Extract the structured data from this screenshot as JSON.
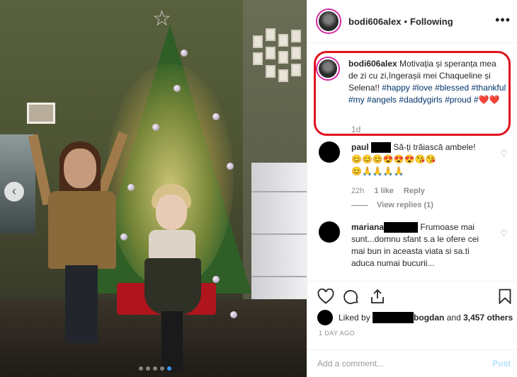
{
  "post": {
    "username": "bodi606alex",
    "separator": "•",
    "follow_status": "Following",
    "more_label": "•••",
    "caption_user": "bodi606alex",
    "caption_text": "Motivația și speranța mea de zi cu zi,îngerașii mei Chaqueline și Selena!!",
    "hashtags": [
      "#happy",
      "#love",
      "#blessed",
      "#thankful",
      "#my",
      "#angels",
      "#daddygirls",
      "#proud",
      "#"
    ],
    "caption_time": "1d",
    "accent_red": "#e0121e"
  },
  "comments": [
    {
      "user": "paul",
      "text": "Să-ți trăiască ambele!",
      "emojis_line1": "😊😊😊😍😍😍😘😘",
      "emojis_line2": "😊🙏🙏🙏🙏",
      "time": "22h",
      "likes": "1 like",
      "reply": "Reply",
      "view_replies": "View replies (1)"
    },
    {
      "user": "mariana",
      "text": "Frumoase mai sunt...domnu sfant s.a le ofere cei mai bun in aceasta viata si sa.ti aduca numai bucurii..."
    }
  ],
  "likes": {
    "prefix": "Liked by",
    "name": "bogdan",
    "and": "and",
    "count": "3,457 others"
  },
  "post_date": "1 DAY AGO",
  "add_comment": {
    "placeholder": "Add a comment...",
    "post_label": "Post"
  },
  "carousel": {
    "slides": 5,
    "active_index": 4
  }
}
